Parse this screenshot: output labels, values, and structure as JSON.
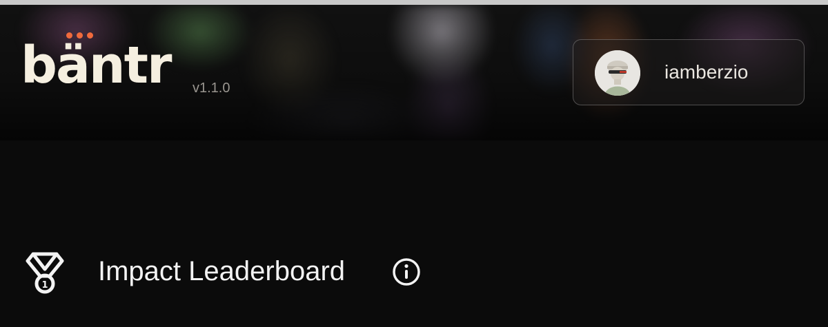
{
  "app": {
    "logo_text": "bäntr",
    "version": "v1.1.0",
    "accent_color": "#f06a3c"
  },
  "user": {
    "username": "iamberzio",
    "avatar_icon": "user-avatar"
  },
  "section": {
    "title": "Impact Leaderboard",
    "icon": "medal-icon",
    "info_icon": "info-icon"
  }
}
